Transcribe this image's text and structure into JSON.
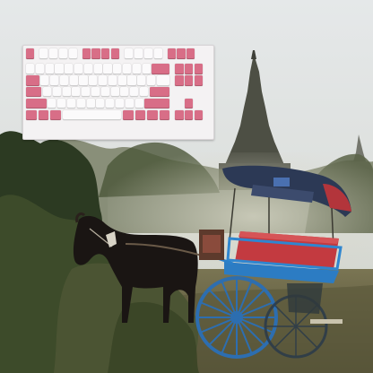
{
  "scene": {
    "description_subjects": [
      "keyboard-overlay",
      "stupa-temple",
      "horse",
      "carriage",
      "shrubs"
    ],
    "keyboard": {
      "layout": "tenkeyless",
      "colors": {
        "alpha_keys": "#fbfafb",
        "accent_keys": "#d86e87",
        "case": "#f4f2f3"
      },
      "rows": [
        [
          "p",
          "gap",
          "w",
          "w",
          "w",
          "w",
          "gap",
          "p",
          "p",
          "p",
          "p",
          "gap",
          "w",
          "w",
          "w",
          "w",
          "gap",
          "p",
          "p",
          "p"
        ],
        [
          "w",
          "w",
          "w",
          "w",
          "w",
          "w",
          "w",
          "w",
          "w",
          "w",
          "w",
          "w",
          "w",
          "pw2",
          "gap",
          "p",
          "p",
          "p"
        ],
        [
          "pw15",
          "w",
          "w",
          "w",
          "w",
          "w",
          "w",
          "w",
          "w",
          "w",
          "w",
          "w",
          "w",
          "w15",
          "gap",
          "p",
          "p",
          "p"
        ],
        [
          "pw175",
          "w",
          "w",
          "w",
          "w",
          "w",
          "w",
          "w",
          "w",
          "w",
          "w",
          "w",
          "pw225"
        ],
        [
          "pw225",
          "w",
          "w",
          "w",
          "w",
          "w",
          "w",
          "w",
          "w",
          "w",
          "w",
          "pw275",
          "gap",
          "sp",
          "p",
          "sp"
        ],
        [
          "p125",
          "p125",
          "p125",
          "w625",
          "p125",
          "p125",
          "p125",
          "p125",
          "gap",
          "p",
          "p",
          "p"
        ]
      ]
    },
    "palette": {
      "sky": "#dfe3e4",
      "haze": "#cfd4cc",
      "stupa": "#4a4c42",
      "foliage_dark": "#2f3a25",
      "foliage_mid": "#55603f",
      "horse": "#1b1614",
      "carriage_frame": "#2a7fc9",
      "carriage_seat": "#c0353d",
      "canopy": "#2c3a56",
      "ground": "#6a6542"
    }
  }
}
